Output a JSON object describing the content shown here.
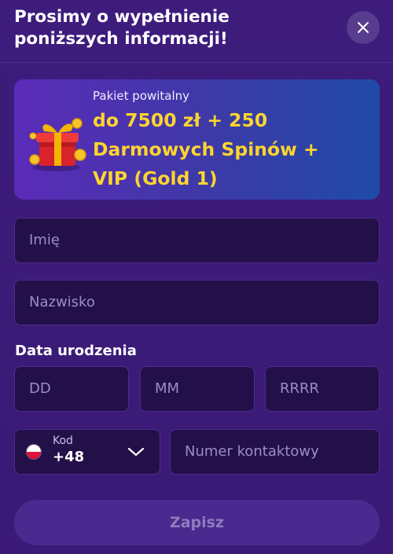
{
  "header": {
    "title_line1": "Prosimy o wypełnienie",
    "title_line2": "poniższych informacji!",
    "close_icon": "close-icon"
  },
  "banner": {
    "subtitle": "Pakiet powitalny",
    "offer_line1": "do 7500 zł + 250",
    "offer_line2": "Darmowych Spinów +",
    "offer_line3": "VIP (Gold 1)",
    "icon": "gift-icon"
  },
  "form": {
    "first_name_placeholder": "Imię",
    "last_name_placeholder": "Nazwisko",
    "dob_label": "Data urodzenia",
    "day_placeholder": "DD",
    "month_placeholder": "MM",
    "year_placeholder": "RRRR",
    "phone_code_label": "Kod",
    "phone_code_value": "+48",
    "phone_placeholder": "Numer kontaktowy",
    "flag_icon": "poland-flag-icon"
  },
  "actions": {
    "submit_label": "Zapisz"
  },
  "colors": {
    "background": "#3b1a78",
    "field_bg": "#241049",
    "accent_yellow": "#ffd52e",
    "placeholder": "#9c8cc6"
  }
}
